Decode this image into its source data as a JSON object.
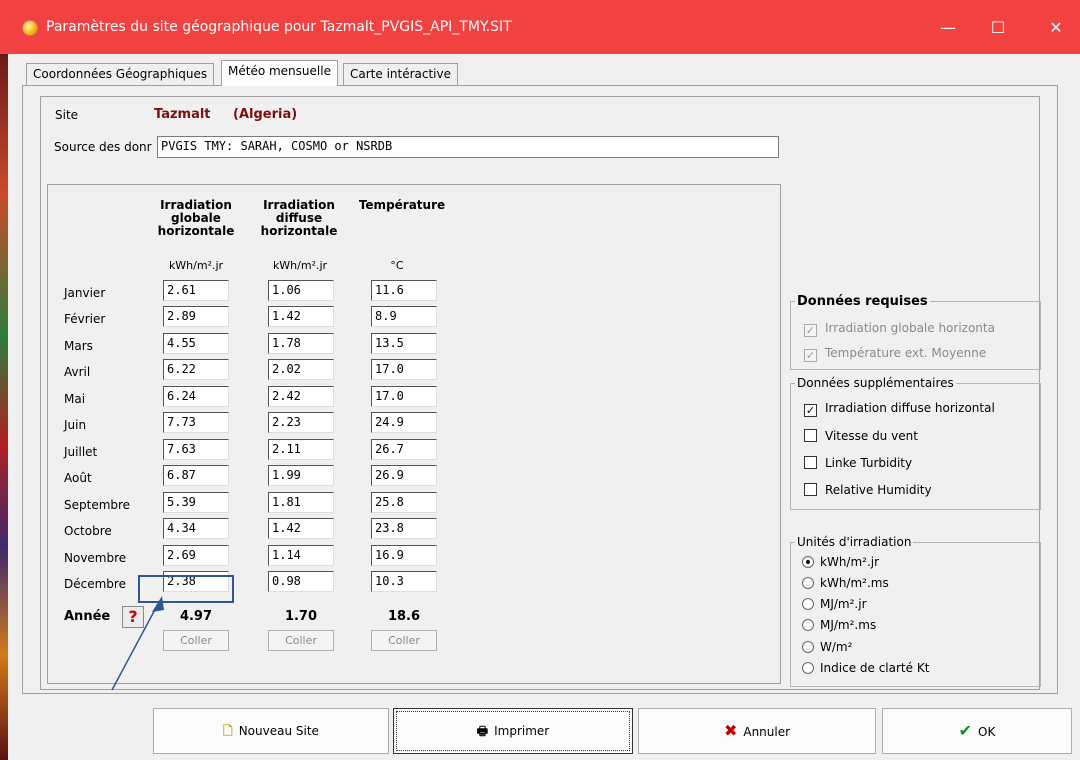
{
  "window": {
    "title": "Paramètres du site géographique pour Tazmalt_PVGIS_API_TMY.SIT",
    "minimize": "—",
    "maximize": "☐",
    "close": "✕"
  },
  "tabs": [
    {
      "label": "Coordonnées Géographiques"
    },
    {
      "label": "Météo mensuelle"
    },
    {
      "label": "Carte intéractive"
    }
  ],
  "site": {
    "label": "Site",
    "name": "Tazmalt",
    "country": "(Algeria)",
    "source_label": "Source des donr",
    "source_value": "PVGIS TMY: SARAH, COSMO or NSRDB"
  },
  "table": {
    "columns": [
      {
        "header_lines": [
          "Irradiation",
          "globale",
          "horizontale"
        ],
        "unit": "kWh/m².jr"
      },
      {
        "header_lines": [
          "Irradiation",
          "diffuse",
          "horizontale"
        ],
        "unit": "kWh/m².jr"
      },
      {
        "header_lines": [
          "Température"
        ],
        "unit": "°C"
      }
    ],
    "rows": [
      {
        "month": "Janvier",
        "values": [
          "2.61",
          "1.06",
          "11.6"
        ]
      },
      {
        "month": "Février",
        "values": [
          "2.89",
          "1.42",
          "8.9"
        ]
      },
      {
        "month": "Mars",
        "values": [
          "4.55",
          "1.78",
          "13.5"
        ]
      },
      {
        "month": "Avril",
        "values": [
          "6.22",
          "2.02",
          "17.0"
        ]
      },
      {
        "month": "Mai",
        "values": [
          "6.24",
          "2.42",
          "17.0"
        ]
      },
      {
        "month": "Juin",
        "values": [
          "7.73",
          "2.23",
          "24.9"
        ]
      },
      {
        "month": "Juillet",
        "values": [
          "7.63",
          "2.11",
          "26.7"
        ]
      },
      {
        "month": "Août",
        "values": [
          "6.87",
          "1.99",
          "26.9"
        ]
      },
      {
        "month": "Septembre",
        "values": [
          "5.39",
          "1.81",
          "25.8"
        ]
      },
      {
        "month": "Octobre",
        "values": [
          "4.34",
          "1.42",
          "23.8"
        ]
      },
      {
        "month": "Novembre",
        "values": [
          "2.69",
          "1.14",
          "16.9"
        ]
      },
      {
        "month": "Décembre",
        "values": [
          "2.38",
          "0.98",
          "10.3"
        ]
      }
    ],
    "year_label": "Année",
    "help": "?",
    "totals": [
      "4.97",
      "1.70",
      "18.6"
    ],
    "paste_label": "Coller"
  },
  "required": {
    "title": "Données requises",
    "items": [
      {
        "label": "Irradiation globale horizonta",
        "checked": true,
        "enabled": false
      },
      {
        "label": "Température ext. Moyenne",
        "checked": true,
        "enabled": false
      }
    ]
  },
  "additional": {
    "title": "Données supplémentaires",
    "items": [
      {
        "label": "Irradiation diffuse horizontal",
        "checked": true
      },
      {
        "label": "Vitesse du vent",
        "checked": false
      },
      {
        "label": "Linke Turbidity",
        "checked": false
      },
      {
        "label": "Relative Humidity",
        "checked": false
      }
    ]
  },
  "units": {
    "title": "Unités d'irradiation",
    "options": [
      {
        "label": "kWh/m².jr",
        "selected": true
      },
      {
        "label": "kWh/m².ms",
        "selected": false
      },
      {
        "label": "MJ/m².jr",
        "selected": false
      },
      {
        "label": "MJ/m².ms",
        "selected": false
      },
      {
        "label": "W/m²",
        "selected": false
      },
      {
        "label": "Indice de clarté Kt",
        "selected": false
      }
    ]
  },
  "buttons": {
    "new_site": "Nouveau Site",
    "print": "Imprimer",
    "cancel": "Annuler",
    "ok": "OK"
  },
  "colors": {
    "titlebar": "#f24141",
    "site_name": "#7a1010",
    "highlight_box": "#2f5597"
  }
}
